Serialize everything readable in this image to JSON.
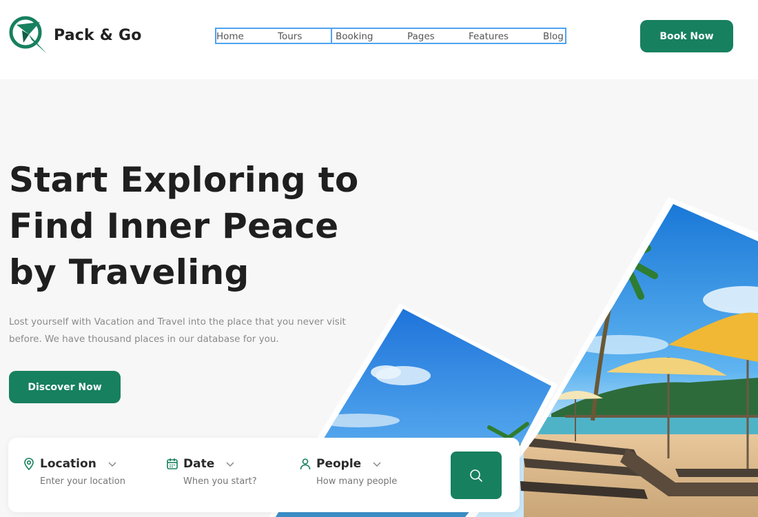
{
  "brand": {
    "name": "Pack & Go",
    "accent": "#17805f"
  },
  "nav": {
    "items": [
      {
        "label": "Home"
      },
      {
        "label": "Tours"
      },
      {
        "label": "Booking"
      },
      {
        "label": "Pages"
      },
      {
        "label": "Features"
      },
      {
        "label": "Blog"
      }
    ]
  },
  "header": {
    "book_label": "Book Now"
  },
  "hero": {
    "title_line1": "Start Exploring to",
    "title_line2": "Find Inner Peace",
    "title_line3": "by Traveling",
    "subtitle_line1": "Lost yourself with Vacation and Travel into the place that you never visit",
    "subtitle_line2": "before. We have thousand places in our database for you.",
    "discover_label": "Discover Now"
  },
  "search": {
    "location": {
      "label": "Location",
      "placeholder": "Enter your location",
      "icon": "map-pin-icon"
    },
    "date": {
      "label": "Date",
      "placeholder": "When you start?",
      "icon": "calendar-icon"
    },
    "people": {
      "label": "People",
      "placeholder": "How many people",
      "icon": "user-icon"
    },
    "submit_icon": "search-icon"
  }
}
